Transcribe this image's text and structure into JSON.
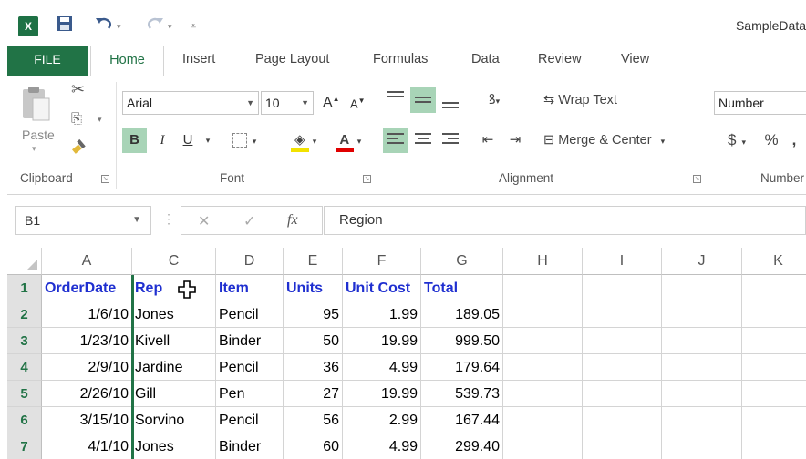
{
  "app": {
    "doc_title": "SampleData",
    "logo_text": "X"
  },
  "quick_access": {
    "save_icon": "save-icon",
    "undo_icon": "undo-icon",
    "redo_icon": "redo-icon",
    "customize_icon": "customize-qat-icon"
  },
  "tabs": {
    "file": "FILE",
    "home": "Home",
    "insert": "Insert",
    "page_layout": "Page Layout",
    "formulas": "Formulas",
    "data": "Data",
    "review": "Review",
    "view": "View"
  },
  "ribbon": {
    "clipboard": {
      "label": "Clipboard",
      "paste": "Paste"
    },
    "font": {
      "label": "Font",
      "font_name": "Arial",
      "font_size": "10",
      "grow": "A",
      "shrink": "A",
      "bold": "B",
      "italic": "I",
      "underline": "U",
      "font_color_letter": "A"
    },
    "alignment": {
      "label": "Alignment",
      "wrap_text": "Wrap Text",
      "merge_center": "Merge & Center"
    },
    "number": {
      "label": "Number",
      "format": "Number",
      "currency": "$",
      "percent": "%"
    }
  },
  "formula_bar": {
    "name_box": "B1",
    "fx": "fx",
    "cancel": "✕",
    "enter": "✓",
    "content": "Region"
  },
  "grid": {
    "columns": [
      "A",
      "C",
      "D",
      "E",
      "F",
      "G",
      "H",
      "I",
      "J",
      "K"
    ],
    "rows": [
      "1",
      "2",
      "3",
      "4",
      "5",
      "6",
      "7"
    ],
    "header_row": [
      "OrderDate",
      "Rep",
      "Item",
      "Units",
      "Unit Cost",
      "Total"
    ],
    "data_rows": [
      [
        "1/6/10",
        "Jones",
        "Pencil",
        "95",
        "1.99",
        "189.05"
      ],
      [
        "1/23/10",
        "Kivell",
        "Binder",
        "50",
        "19.99",
        "999.50"
      ],
      [
        "2/9/10",
        "Jardine",
        "Pencil",
        "36",
        "4.99",
        "179.64"
      ],
      [
        "2/26/10",
        "Gill",
        "Pen",
        "27",
        "19.99",
        "539.73"
      ],
      [
        "3/15/10",
        "Sorvino",
        "Pencil",
        "56",
        "2.99",
        "167.44"
      ],
      [
        "4/1/10",
        "Jones",
        "Binder",
        "60",
        "4.99",
        "299.40"
      ]
    ]
  },
  "colors": {
    "excel_green": "#217346",
    "header_text_blue": "#1f2fd0",
    "selected_button": "#a8d4b7"
  }
}
